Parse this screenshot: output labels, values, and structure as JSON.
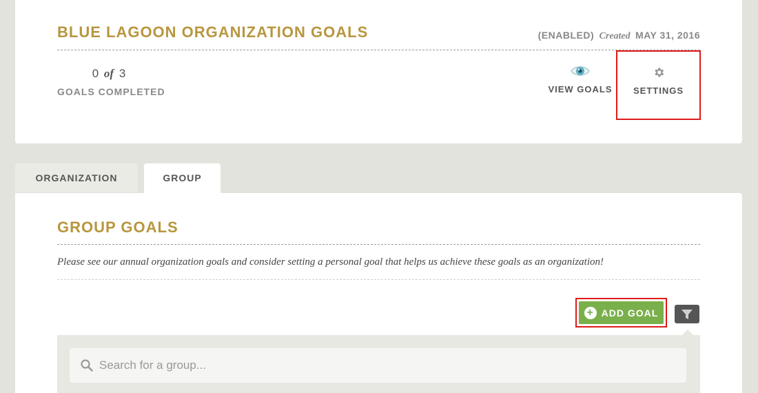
{
  "header": {
    "title": "BLUE LAGOON ORGANIZATION GOALS",
    "status": "(ENABLED)",
    "created_label": "Created",
    "created_date": "MAY 31, 2016"
  },
  "progress": {
    "completed": "0",
    "of_label": "of",
    "total": "3",
    "label": "GOALS COMPLETED"
  },
  "actions": {
    "view_goals": "VIEW GOALS",
    "settings": "SETTINGS"
  },
  "tabs": [
    {
      "label": "ORGANIZATION",
      "active": false
    },
    {
      "label": "GROUP",
      "active": true
    }
  ],
  "group": {
    "title": "GROUP GOALS",
    "description": "Please see our annual organization goals and consider setting a personal goal that helps us achieve these goals as an organization!",
    "add_goal_label": "ADD GOAL"
  },
  "search": {
    "placeholder": "Search for a group..."
  },
  "colors": {
    "accent_gold": "#b8963e",
    "add_green": "#7ab04c",
    "highlight_red": "#e01919"
  }
}
